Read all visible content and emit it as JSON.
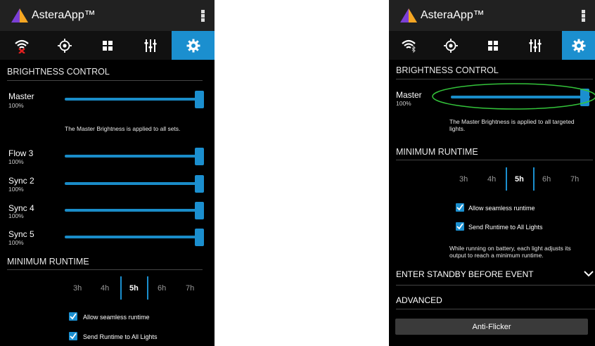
{
  "colors": {
    "accent": "#1b8fcf",
    "background": "#000000",
    "appbar": "#212121",
    "highlight_ellipse": "#33c33a"
  },
  "left": {
    "app_title": "AsteraApp™",
    "tabs": [
      "wifi-disconnected-icon",
      "target-icon",
      "grid-icon",
      "sliders-icon",
      "settings-gear-icon"
    ],
    "active_tab": 4,
    "brightness_header": "BRIGHTNESS CONTROL",
    "master": {
      "label": "Master",
      "value": "100%",
      "level": 1.0
    },
    "master_note": "The Master Brightness is applied to all sets.",
    "sliders": [
      {
        "label": "Flow 3",
        "value": "100%",
        "level": 1.0
      },
      {
        "label": "Sync 2",
        "value": "100%",
        "level": 1.0
      },
      {
        "label": "Sync 4",
        "value": "100%",
        "level": 1.0
      },
      {
        "label": "Sync 5",
        "value": "100%",
        "level": 1.0
      }
    ],
    "runtime_header": "MINIMUM RUNTIME",
    "runtime_options": [
      "3h",
      "4h",
      "5h",
      "6h",
      "7h"
    ],
    "runtime_selected": "5h",
    "checkboxes": [
      {
        "label": "Allow seamless runtime",
        "checked": true
      },
      {
        "label": "Send Runtime to All Lights",
        "checked": true
      }
    ]
  },
  "right": {
    "app_title": "AsteraApp™",
    "tabs": [
      "wifi-bluetooth-icon",
      "target-icon",
      "grid-icon",
      "sliders-icon",
      "settings-gear-icon"
    ],
    "active_tab": 4,
    "brightness_header": "BRIGHTNESS CONTROL",
    "master": {
      "label": "Master",
      "value": "100%",
      "level": 1.0
    },
    "master_note_line1": "The Master Brightness is applied to all targeted",
    "master_note_line2": "lights.",
    "runtime_header": "MINIMUM RUNTIME",
    "runtime_options": [
      "3h",
      "4h",
      "5h",
      "6h",
      "7h"
    ],
    "runtime_selected": "5h",
    "checkboxes": [
      {
        "label": "Allow seamless runtime",
        "checked": true
      },
      {
        "label": "Send Runtime to All Lights",
        "checked": true
      }
    ],
    "battery_note_line1": "While running on battery, each light adjusts its",
    "battery_note_line2": "output to reach a minimum runtime.",
    "standby_title": "ENTER STANDBY BEFORE EVENT",
    "advanced_title": "ADVANCED",
    "anti_flicker_label": "Anti-Flicker"
  }
}
